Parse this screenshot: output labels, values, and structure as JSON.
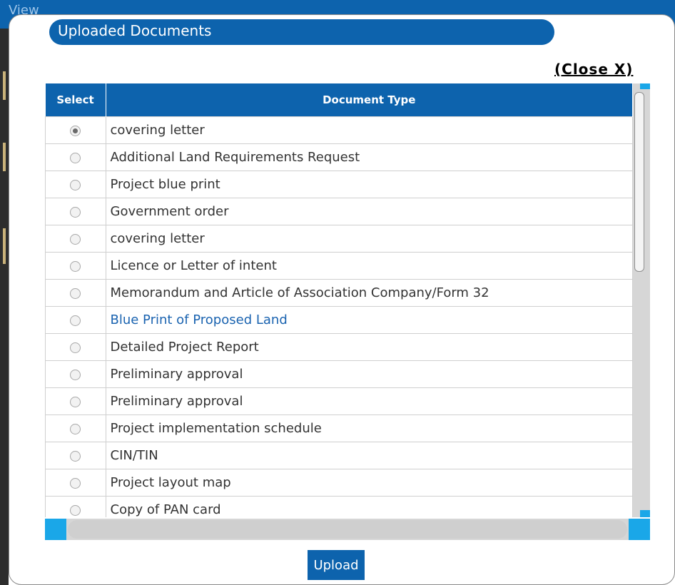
{
  "background": {
    "view_label": "View"
  },
  "modal": {
    "title": "Uploaded Documents",
    "close_label": "(Close X)",
    "upload_label": "Upload"
  },
  "table": {
    "headers": [
      "Select",
      "Document Type"
    ],
    "rows": [
      {
        "label": "covering letter",
        "selected": true,
        "highlight": false
      },
      {
        "label": "Additional Land Requirements Request",
        "selected": false,
        "highlight": false
      },
      {
        "label": "Project blue print",
        "selected": false,
        "highlight": false
      },
      {
        "label": "Government order",
        "selected": false,
        "highlight": false
      },
      {
        "label": "covering letter",
        "selected": false,
        "highlight": false
      },
      {
        "label": "Licence or Letter of intent",
        "selected": false,
        "highlight": false
      },
      {
        "label": "Memorandum and Article of Association Company/Form 32",
        "selected": false,
        "highlight": false
      },
      {
        "label": "Blue Print of Proposed Land",
        "selected": false,
        "highlight": true
      },
      {
        "label": "Detailed Project Report",
        "selected": false,
        "highlight": false
      },
      {
        "label": "Preliminary approval",
        "selected": false,
        "highlight": false
      },
      {
        "label": "Preliminary approval",
        "selected": false,
        "highlight": false
      },
      {
        "label": "Project implementation schedule",
        "selected": false,
        "highlight": false
      },
      {
        "label": "CIN/TIN",
        "selected": false,
        "highlight": false
      },
      {
        "label": "Project layout map",
        "selected": false,
        "highlight": false
      },
      {
        "label": "Copy of PAN card",
        "selected": false,
        "highlight": false
      }
    ]
  },
  "colors": {
    "primary": "#0d63ad",
    "scroll_accent": "#1aa7e8",
    "link": "#1a63b0"
  }
}
